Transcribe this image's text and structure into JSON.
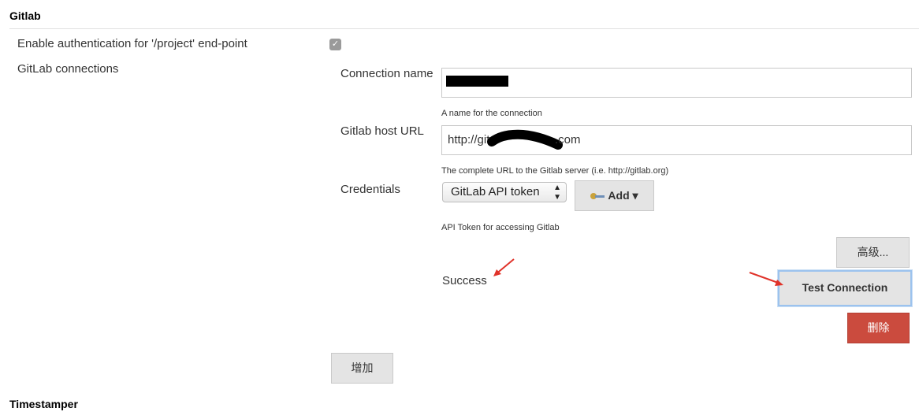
{
  "section": {
    "title": "Gitlab",
    "next_section_title": "Timestamper"
  },
  "auth": {
    "label": "Enable authentication for '/project' end-point",
    "checked": true,
    "check_glyph": "✓"
  },
  "connections": {
    "label": "GitLab connections",
    "connection_name": {
      "label": "Connection name",
      "value": "",
      "help": "A name for the connection"
    },
    "host_url": {
      "label": "Gitlab host URL",
      "value": "http://git.",
      "value_suffix": ".com",
      "help": "The complete URL to the Gitlab server (i.e. http://gitlab.org)"
    },
    "credentials": {
      "label": "Credentials",
      "selected": "GitLab API token",
      "select_arrows": "▲\n▼",
      "add_label": "Add ▾",
      "add_icon": "key-icon",
      "help": "API Token for accessing Gitlab"
    },
    "advanced_label": "高级...",
    "status_text": "Success",
    "test_label": "Test Connection",
    "delete_label": "删除",
    "delete_color": "#cb4b3e"
  },
  "add_connection_label": "增加",
  "annotation_color": "#e0332a"
}
